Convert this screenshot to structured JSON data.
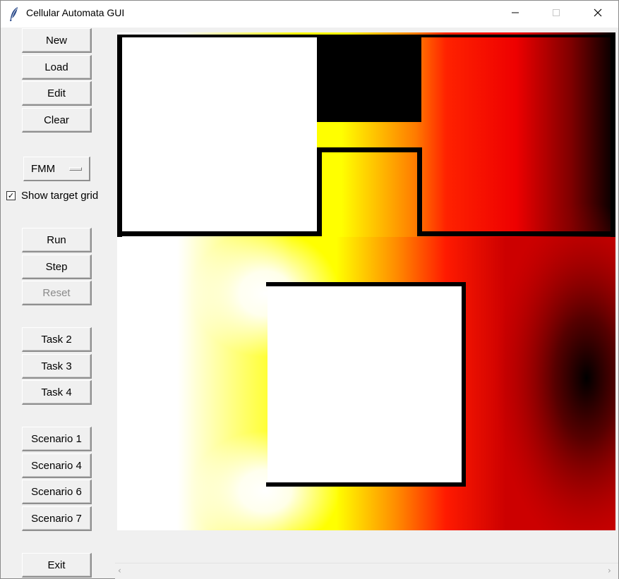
{
  "window": {
    "title": "Cellular Automata GUI",
    "icons": {
      "app": "feather-icon",
      "minimize": "minimize-icon",
      "maximize": "maximize-icon",
      "close": "close-icon"
    }
  },
  "sidebar": {
    "file_buttons": [
      "New",
      "Load",
      "Edit",
      "Clear"
    ],
    "algorithm": {
      "selected": "FMM"
    },
    "show_target_grid": {
      "label": "Show target grid",
      "checked": true,
      "mark": "✓"
    },
    "sim_buttons": [
      {
        "label": "Run",
        "enabled": true
      },
      {
        "label": "Step",
        "enabled": true
      },
      {
        "label": "Reset",
        "enabled": false
      }
    ],
    "task_buttons": [
      "Task 2",
      "Task 3",
      "Task 4"
    ],
    "scenario_buttons": [
      "Scenario 1",
      "Scenario 4",
      "Scenario 6",
      "Scenario 7"
    ],
    "exit_button": "Exit"
  },
  "canvas": {
    "colormap": [
      "#ffffff",
      "#ffff00",
      "#ff8c00",
      "#ff0000",
      "#000000"
    ],
    "wall_color": "#000000",
    "target_color": "#000000"
  },
  "scrollbar": {
    "left_arrow": "‹",
    "right_arrow": "›"
  }
}
